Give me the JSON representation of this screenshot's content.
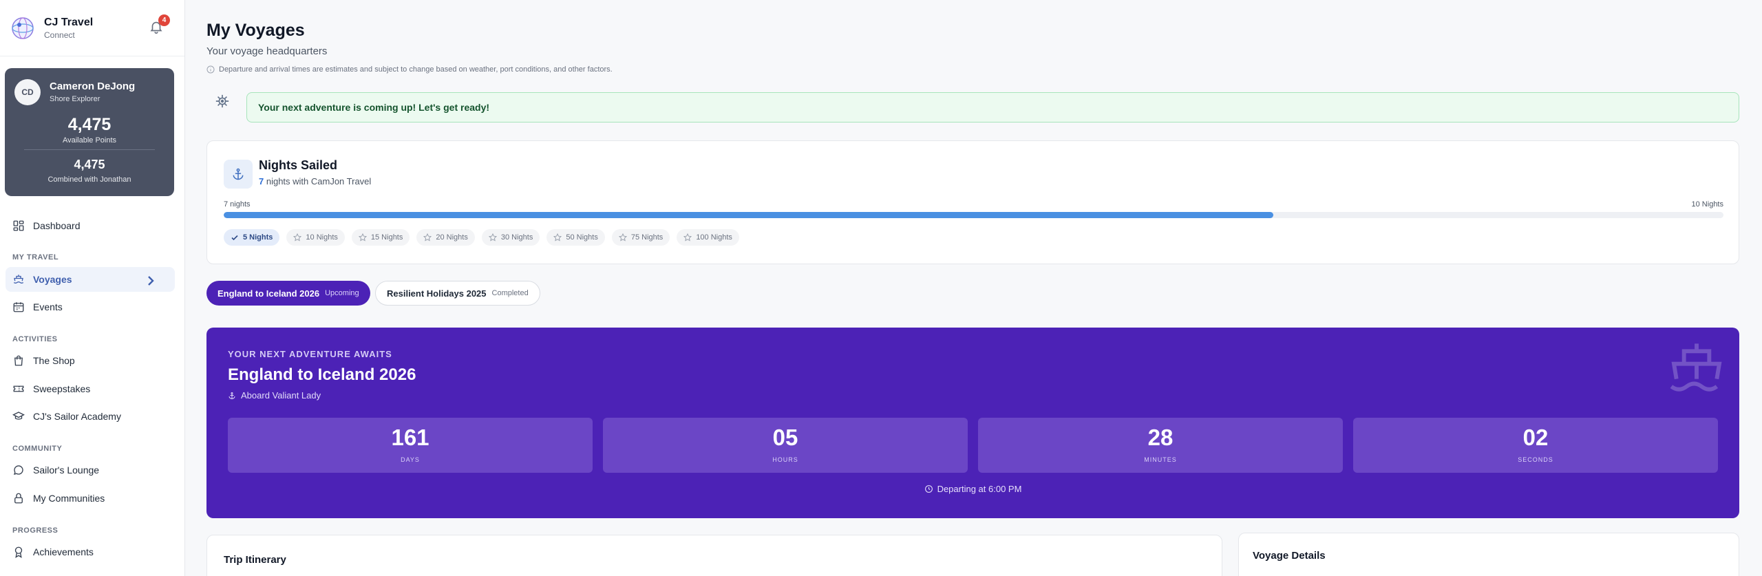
{
  "brand": {
    "name": "CJ Travel",
    "subtitle": "Connect",
    "notification_count": "4"
  },
  "profile": {
    "initials": "CD",
    "name": "Cameron DeJong",
    "role": "Shore Explorer",
    "points": "4,475",
    "points_label": "Available Points",
    "combined": "4,475",
    "combined_label": "Combined with Jonathan"
  },
  "nav": {
    "dashboard": "Dashboard",
    "section_travel": "MY TRAVEL",
    "voyages": "Voyages",
    "events": "Events",
    "section_activities": "ACTIVITIES",
    "shop": "The Shop",
    "sweepstakes": "Sweepstakes",
    "academy": "CJ's Sailor Academy",
    "section_community": "COMMUNITY",
    "lounge": "Sailor's Lounge",
    "communities": "My Communities",
    "section_progress": "PROGRESS",
    "achievements": "Achievements"
  },
  "page": {
    "title": "My Voyages",
    "subtitle": "Your voyage headquarters",
    "notice": "Departure and arrival times are estimates and subject to change based on weather, port conditions, and other factors.",
    "banner": "Your next adventure is coming up! Let's get ready!"
  },
  "nights": {
    "title": "Nights Sailed",
    "count": "7",
    "with_text": " nights with CamJon Travel",
    "progress_left": "7 nights",
    "progress_right": "10 Nights",
    "progress_fraction": 0.7,
    "milestones": [
      "5 Nights",
      "10 Nights",
      "15 Nights",
      "20 Nights",
      "30 Nights",
      "50 Nights",
      "75 Nights",
      "100 Nights"
    ]
  },
  "tabs": [
    {
      "label": "England to Iceland 2026",
      "tag": "Upcoming"
    },
    {
      "label": "Resilient Holidays 2025",
      "tag": "Completed"
    }
  ],
  "hero": {
    "eyebrow": "YOUR NEXT ADVENTURE AWAITS",
    "title": "England to Iceland 2026",
    "ship": "Aboard Valiant Lady",
    "countdown": [
      {
        "value": "161",
        "label": "DAYS"
      },
      {
        "value": "05",
        "label": "HOURS"
      },
      {
        "value": "28",
        "label": "MINUTES"
      },
      {
        "value": "02",
        "label": "SECONDS"
      }
    ],
    "departing": "Departing at 6:00 PM"
  },
  "sections": {
    "itinerary": "Trip Itinerary",
    "details": "Voyage Details"
  },
  "colors": {
    "brand_purple": "#4c22b6",
    "accent_blue": "#4a90e2",
    "sidebar_card": "#4a5163"
  }
}
